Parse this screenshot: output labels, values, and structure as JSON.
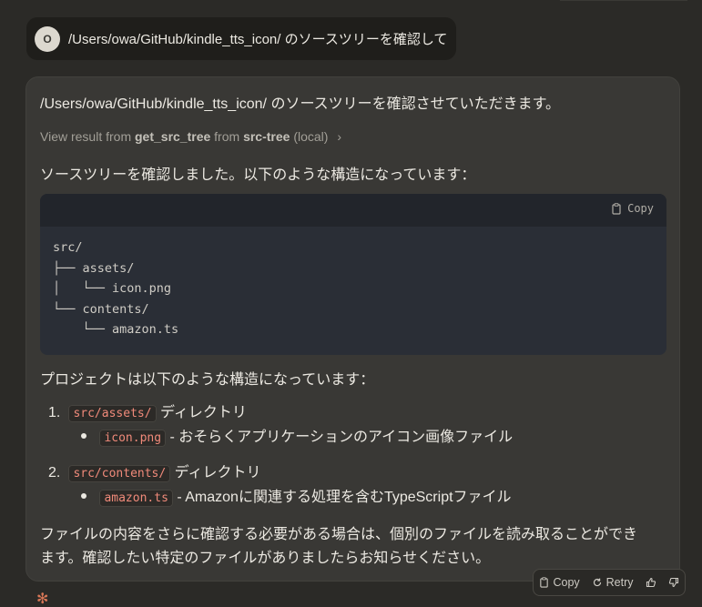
{
  "user_message": {
    "avatar_initial": "O",
    "text": "/Users/owa/GitHub/kindle_tts_icon/ のソースツリーを確認して"
  },
  "reply": {
    "intro": "/Users/owa/GitHub/kindle_tts_icon/ のソースツリーを確認させていただきます。",
    "tool": {
      "prefix": "View result from",
      "tool_name": "get_src_tree",
      "from_word": "from",
      "server": "src-tree",
      "scope": "(local)"
    },
    "after_tool": "ソースツリーを確認しました。以下のような構造になっています：",
    "code": {
      "copy_label": "Copy",
      "lines": [
        "src/",
        "├── assets/",
        "│   └── icon.png",
        "└── contents/",
        "    └── amazon.ts"
      ]
    },
    "structure_heading": "プロジェクトは以下のような構造になっています：",
    "items": [
      {
        "number": "1.",
        "path": "src/assets/",
        "suffix": "ディレクトリ",
        "child_code": "icon.png",
        "child_text": "- おそらくアプリケーションのアイコン画像ファイル"
      },
      {
        "number": "2.",
        "path": "src/contents/",
        "suffix": "ディレクトリ",
        "child_code": "amazon.ts",
        "child_text": "- Amazonに関連する処理を含むTypeScriptファイル"
      }
    ],
    "closing_line1": "ファイルの内容をさらに確認する必要がある場合は、個別のファイルを読み取ることができ",
    "closing_line2": "ます。確認したい特定のファイルがありましたらお知らせください。"
  },
  "actions": {
    "copy": "Copy",
    "retry": "Retry",
    "icons": [
      "copy-icon",
      "retry-icon",
      "thumbs-up-icon",
      "thumbs-down-icon"
    ]
  },
  "colors": {
    "accent_logo": "#d97757",
    "inline_code": "#f08a7a"
  }
}
